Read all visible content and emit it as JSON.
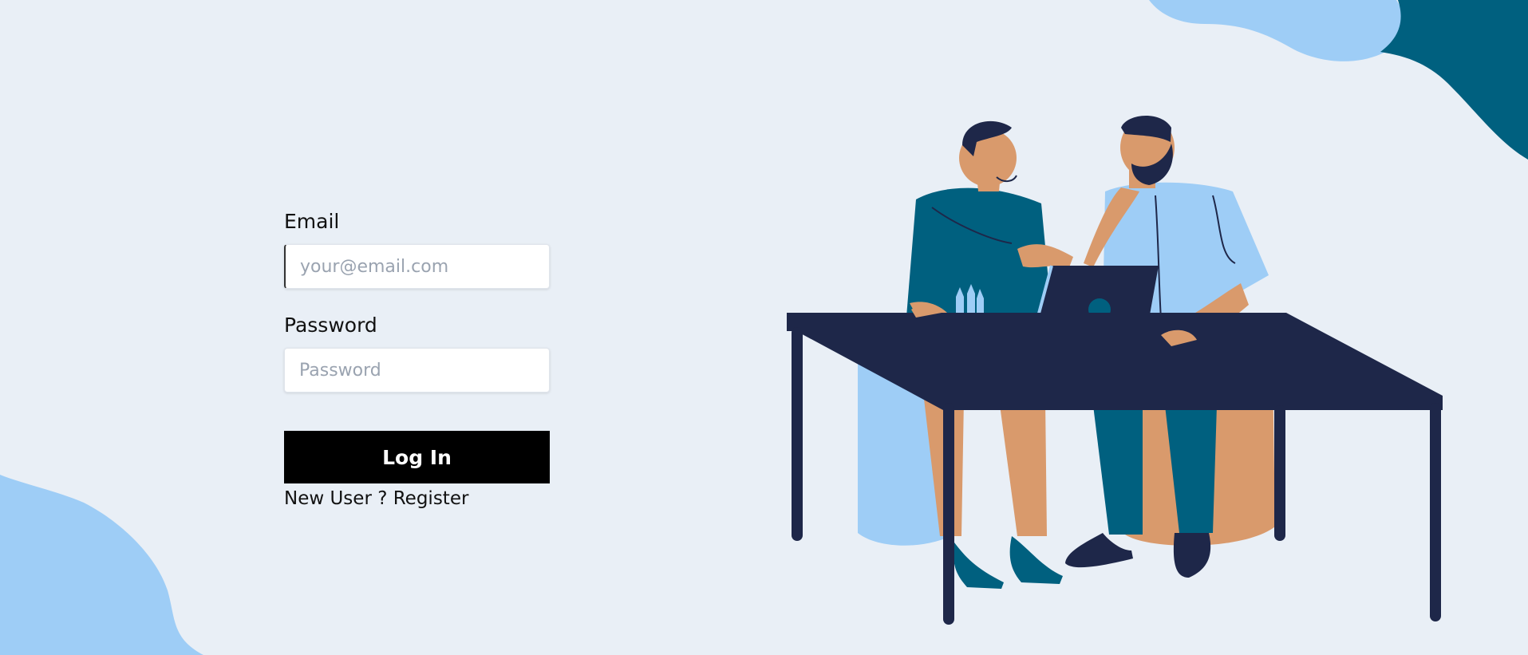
{
  "login": {
    "email_label": "Email",
    "email_placeholder": "your@email.com",
    "password_label": "Password",
    "password_placeholder": "Password",
    "submit_label": "Log In",
    "register_prefix": "New User ?",
    "register_link": "Register"
  },
  "colors": {
    "background": "#e9eff6",
    "blob_light": "#9ecdf6",
    "blob_dark": "#00607f",
    "button": "#000000",
    "table": "#1e2749"
  }
}
